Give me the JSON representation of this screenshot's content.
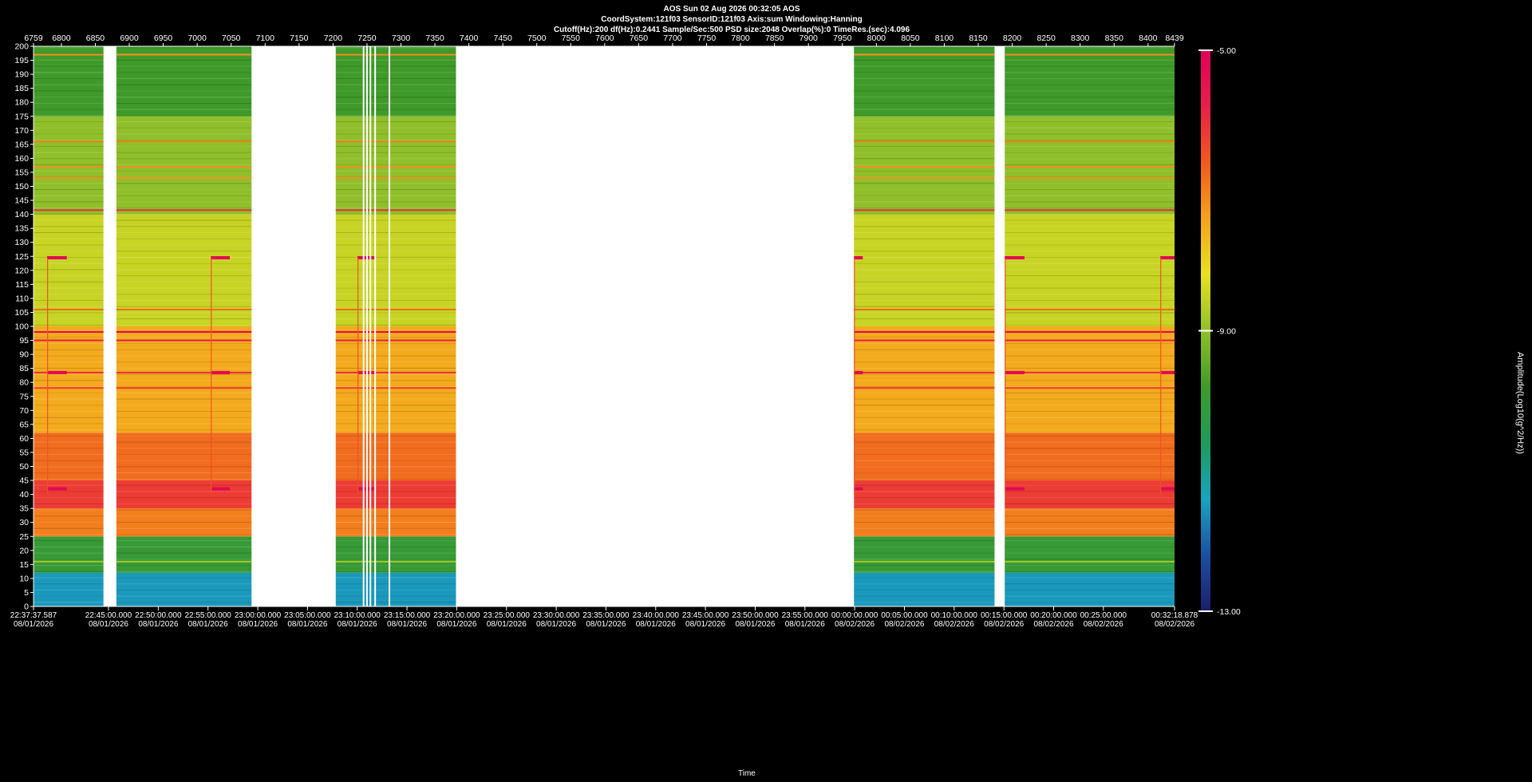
{
  "header": {
    "line1": "AOS  Sun 02 Aug 2026 00:32:05  AOS",
    "line2": "CoordSystem:121f03   SensorID:121f03   Axis:sum    Windowing:Hanning",
    "line3": "Cutoff(Hz):200     df(Hz):0.2441     Sample/Sec:500     PSD size:2048     Overlap(%):0     TimeRes.(sec):4.096"
  },
  "chart_data": {
    "type": "heatmap",
    "title": "AOS  Sun 02 Aug 2026 00:32:05  AOS",
    "xlabel": "Time",
    "ylabel": "",
    "colorbar_label": "Amplitude(Log10(g^2/Hz))",
    "ylim": [
      0,
      200
    ],
    "y_ticks": [
      200,
      195,
      190,
      185,
      180,
      175,
      170,
      165,
      160,
      155,
      150,
      145,
      140,
      135,
      130,
      125,
      120,
      115,
      110,
      105,
      100,
      95,
      90,
      85,
      80,
      75,
      70,
      65,
      60,
      55,
      50,
      45,
      40,
      35,
      30,
      25,
      20,
      15,
      10,
      5,
      0
    ],
    "x_index_range": [
      6759,
      8439
    ],
    "top_ticks": [
      6759,
      6800,
      6850,
      6900,
      6950,
      7000,
      7050,
      7100,
      7150,
      7200,
      7250,
      7300,
      7350,
      7400,
      7450,
      7500,
      7550,
      7600,
      7650,
      7700,
      7750,
      7800,
      7850,
      7900,
      7950,
      8000,
      8050,
      8100,
      8150,
      8200,
      8250,
      8300,
      8350,
      8400,
      8439
    ],
    "time_ticks": [
      {
        "index": 6759,
        "time": "22:37:37.587",
        "date": "08/01/2026"
      },
      {
        "index": 6869.4,
        "time": "22:45:00.000",
        "date": "08/01/2026"
      },
      {
        "index": 6942.7,
        "time": "22:50:00.000",
        "date": "08/01/2026"
      },
      {
        "index": 7015.9,
        "time": "22:55:00.000",
        "date": "08/01/2026"
      },
      {
        "index": 7089.2,
        "time": "23:00:00.000",
        "date": "08/01/2026"
      },
      {
        "index": 7162.4,
        "time": "23:05:00.000",
        "date": "08/01/2026"
      },
      {
        "index": 7235.6,
        "time": "23:10:00.000",
        "date": "08/01/2026"
      },
      {
        "index": 7308.9,
        "time": "23:15:00.000",
        "date": "08/01/2026"
      },
      {
        "index": 7382.1,
        "time": "23:20:00.000",
        "date": "08/01/2026"
      },
      {
        "index": 7455.4,
        "time": "23:25:00.000",
        "date": "08/01/2026"
      },
      {
        "index": 7528.6,
        "time": "23:30:00.000",
        "date": "08/01/2026"
      },
      {
        "index": 7601.8,
        "time": "23:35:00.000",
        "date": "08/01/2026"
      },
      {
        "index": 7675.1,
        "time": "23:40:00.000",
        "date": "08/01/2026"
      },
      {
        "index": 7748.3,
        "time": "23:45:00.000",
        "date": "08/01/2026"
      },
      {
        "index": 7821.6,
        "time": "23:50:00.000",
        "date": "08/01/2026"
      },
      {
        "index": 7894.8,
        "time": "23:55:00.000",
        "date": "08/01/2026"
      },
      {
        "index": 7968,
        "time": "00:00:00.000",
        "date": "08/02/2026"
      },
      {
        "index": 8041.3,
        "time": "00:05:00.000",
        "date": "08/02/2026"
      },
      {
        "index": 8114.5,
        "time": "00:10:00.000",
        "date": "08/02/2026"
      },
      {
        "index": 8187.8,
        "time": "00:15:00.000",
        "date": "08/02/2026"
      },
      {
        "index": 8261,
        "time": "00:20:00.000",
        "date": "08/02/2026"
      },
      {
        "index": 8334.2,
        "time": "00:25:00.000",
        "date": "08/02/2026"
      },
      {
        "index": 8439,
        "time": "00:32:18.878",
        "date": "08/02/2026"
      }
    ],
    "colorbar": {
      "min": -13.0,
      "max": -5.0,
      "ticks": [
        "-5.00",
        "-9.00",
        "-13.00"
      ],
      "colors": [
        "#1b1f6b",
        "#1c4fa0",
        "#1aa3c0",
        "#1e9a5a",
        "#3f9a2a",
        "#8fbf2a",
        "#e8e020",
        "#f4a21c",
        "#f05a1e",
        "#e81e4a",
        "#e0005a"
      ]
    },
    "data_segments": [
      [
        6759,
        6862
      ],
      [
        6881,
        7080
      ],
      [
        7204,
        7381
      ],
      [
        7967,
        8174
      ],
      [
        8189,
        8439
      ]
    ],
    "gap_lines": [
      7245,
      7250,
      7255,
      7262,
      7283
    ],
    "frequency_bands": [
      {
        "y_min": 0,
        "y_max": 12,
        "level": -11.5
      },
      {
        "y_min": 12,
        "y_max": 25,
        "level": -10.0
      },
      {
        "y_min": 25,
        "y_max": 35,
        "level": -7.0
      },
      {
        "y_min": 35,
        "y_max": 45,
        "level": -6.2
      },
      {
        "y_min": 45,
        "y_max": 62,
        "level": -6.8
      },
      {
        "y_min": 62,
        "y_max": 100,
        "level": -7.5
      },
      {
        "y_min": 100,
        "y_max": 140,
        "level": -8.5
      },
      {
        "y_min": 140,
        "y_max": 175,
        "level": -9.0
      },
      {
        "y_min": 175,
        "y_max": 200,
        "level": -9.8
      }
    ],
    "tones": [
      {
        "freq": 141.5,
        "level": -6.0
      },
      {
        "freq": 98,
        "level": -5.2
      },
      {
        "freq": 95,
        "level": -5.8
      },
      {
        "freq": 83.5,
        "level": -6.0
      },
      {
        "freq": 78,
        "level": -6.2
      },
      {
        "freq": 197,
        "level": -7.2
      },
      {
        "freq": 166,
        "level": -7.0
      },
      {
        "freq": 157,
        "level": -7.2
      },
      {
        "freq": 153,
        "level": -7.2
      },
      {
        "freq": 106,
        "level": -6.8
      },
      {
        "freq": 16,
        "level": -8.8
      }
    ],
    "events": [
      {
        "start": 6779,
        "end": 6808,
        "freqs": [
          124.5,
          83.5,
          42
        ],
        "level": -5.2
      },
      {
        "start": 7020,
        "end": 7048,
        "freqs": [
          124.5,
          83.5,
          42
        ],
        "level": -5.2
      },
      {
        "start": 7236,
        "end": 7263,
        "freqs": [
          124.5,
          83.5,
          42
        ],
        "level": -5.2
      },
      {
        "start": 7967,
        "end": 7980,
        "freqs": [
          124.5,
          83.5,
          42
        ],
        "level": -5.2
      },
      {
        "start": 8189,
        "end": 8218,
        "freqs": [
          124.5,
          83.5,
          42
        ],
        "level": -5.2
      },
      {
        "start": 8418,
        "end": 8439,
        "freqs": [
          124.5,
          83.5,
          42
        ],
        "level": -5.2
      }
    ]
  }
}
